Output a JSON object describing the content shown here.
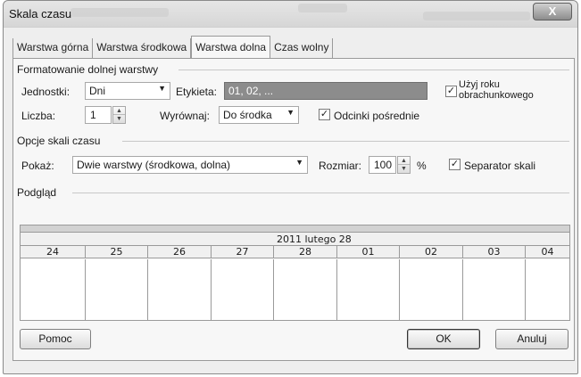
{
  "window": {
    "title": "Skala czasu",
    "close_label": "X"
  },
  "tabs": [
    {
      "label": "Warstwa górna",
      "active": false
    },
    {
      "label": "Warstwa środkowa",
      "active": false
    },
    {
      "label": "Warstwa dolna",
      "active": true
    },
    {
      "label": "Czas wolny",
      "active": false
    }
  ],
  "format_section": {
    "title": "Formatowanie dolnej warstwy",
    "units_label": "Jednostki:",
    "units_value": "Dni",
    "label_label": "Etykieta:",
    "label_value": "01, 02, ...",
    "fiscal_year_label_line1": "Użyj roku",
    "fiscal_year_label_line2": "obrachunkowego",
    "fiscal_year_checked": true,
    "count_label": "Liczba:",
    "count_value": "1",
    "align_label": "Wyrównaj:",
    "align_value": "Do środka",
    "tick_lines_label": "Odcinki pośrednie",
    "tick_lines_checked": true
  },
  "options_section": {
    "title": "Opcje skali czasu",
    "show_label": "Pokaż:",
    "show_value": "Dwie warstwy (środkowa, dolna)",
    "size_label": "Rozmiar:",
    "size_value": "100",
    "size_unit": "%",
    "separator_label": "Separator skali",
    "separator_checked": true
  },
  "preview": {
    "title": "Podgląd",
    "middle_tier_label": "2011 lutego 28",
    "days": [
      "24",
      "25",
      "26",
      "27",
      "28",
      "01",
      "02",
      "03",
      "04"
    ]
  },
  "buttons": {
    "help": "Pomoc",
    "ok": "OK",
    "cancel": "Anuluj"
  },
  "icons": {
    "dropdown": "chevron-down-icon",
    "spin_up": "spin-up-icon",
    "spin_down": "spin-down-icon",
    "check": "checkmark-icon"
  },
  "colors": {
    "highlight_combo": "#8c8c8c",
    "window_bg": "#eeeeee",
    "panel_bg": "#f7f7f7"
  }
}
